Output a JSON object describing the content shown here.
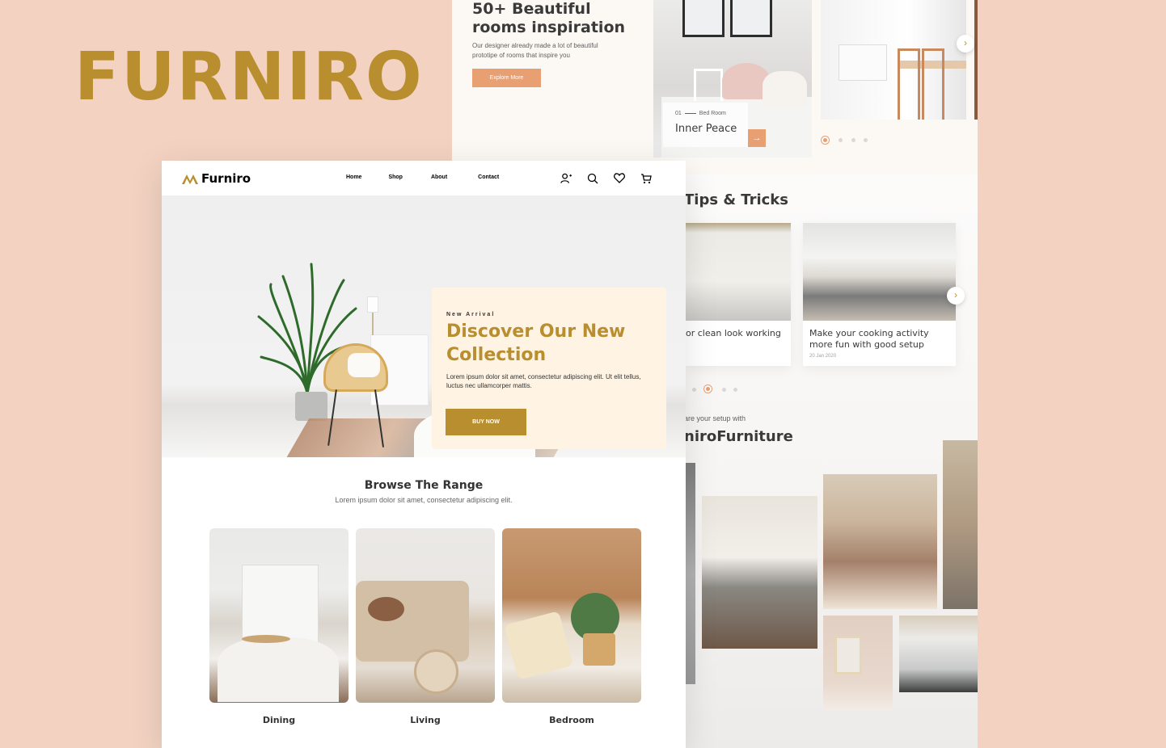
{
  "brand_heading": "FURNIRO",
  "inspiration": {
    "title": "50+ Beautiful rooms inspiration",
    "subtitle": "Our designer already made a lot of beautiful prototipe of rooms that inspire you",
    "button": "Explore More",
    "room_card": {
      "number": "01",
      "category": "Bed Room",
      "name": "Inner Peace",
      "arrow": "→"
    },
    "next": "›"
  },
  "tips": {
    "title": "Tips & Tricks",
    "cards": [
      {
        "title": "or clean look working",
        "date": ""
      },
      {
        "title": "Make your cooking activity more fun with good setup",
        "date": "20 Jan 2020"
      }
    ],
    "next": "›"
  },
  "share": {
    "subtitle": "are your setup with",
    "title": "niroFurniture"
  },
  "nav": {
    "logo_text": "Furniro",
    "links": [
      "Home",
      "Shop",
      "About",
      "Contact"
    ],
    "icons": [
      "account-icon",
      "search-icon",
      "heart-icon",
      "cart-icon"
    ]
  },
  "hero": {
    "kicker": "New Arrival",
    "title": "Discover Our New Collection",
    "body": "Lorem ipsum dolor sit amet, consectetur adipiscing elit. Ut elit tellus, luctus nec ullamcorper mattis.",
    "button": "BUY NOW"
  },
  "browse": {
    "title": "Browse The Range",
    "subtitle": "Lorem ipsum dolor sit amet, consectetur adipiscing elit.",
    "categories": [
      "Dining",
      "Living",
      "Bedroom"
    ]
  },
  "colors": {
    "accent": "#b88e2f",
    "peach": "#e89f71",
    "background": "#f3d2c1",
    "promo_bg": "#fff3e3"
  }
}
